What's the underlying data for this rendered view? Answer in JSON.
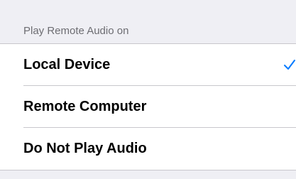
{
  "section": {
    "header": "Play Remote Audio on"
  },
  "options": [
    {
      "label": "Local Device",
      "selected": true
    },
    {
      "label": "Remote Computer",
      "selected": false
    },
    {
      "label": "Do Not Play Audio",
      "selected": false
    }
  ],
  "colors": {
    "accent": "#007aff",
    "background": "#efeff4",
    "separator": "#c8c7cc",
    "header_text": "#6d6d72"
  },
  "icons": {
    "selected": "checkmark-icon"
  }
}
